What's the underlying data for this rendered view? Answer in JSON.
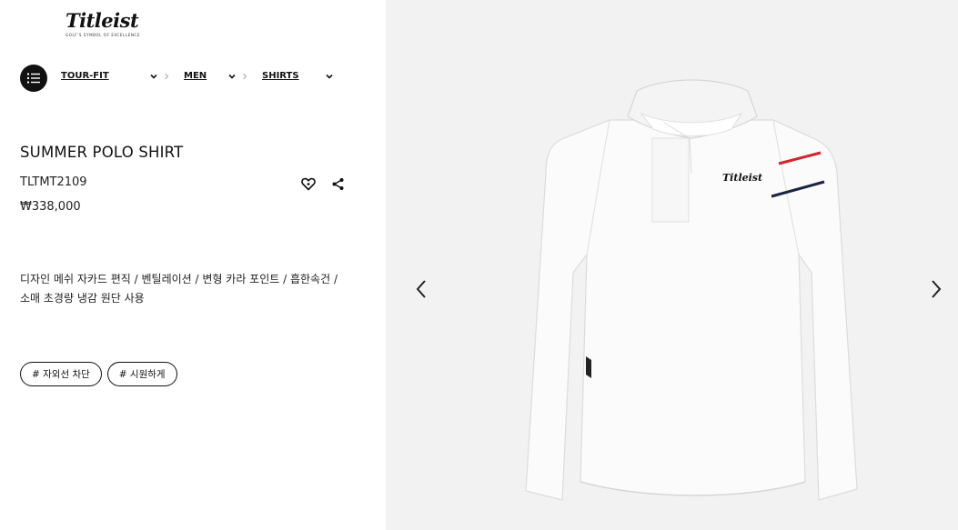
{
  "brand": {
    "name": "Titleist",
    "tagline": "GOLF'S SYMBOL OF EXCELLENCE"
  },
  "nav": {
    "menu_icon": "list-icon",
    "breadcrumbs": [
      {
        "label": "TOUR-FIT"
      },
      {
        "label": "MEN"
      },
      {
        "label": "SHIRTS"
      }
    ]
  },
  "product": {
    "name": "SUMMER POLO SHIRT",
    "code": "TLTMT2109",
    "price": "₩338,000",
    "description": "디자인 메쉬 자카드 편직 / 벤틸레이션 / 변형 카라 포인트 / 흡한속건 / 소매 초경량 냉감 원단 사용",
    "tags": [
      "# 자외선 차단",
      "# 시원하게"
    ],
    "image_logo_text": "Titleist",
    "actions": {
      "wishlist_icon": "heart-icon",
      "share_icon": "share-icon"
    }
  },
  "gallery": {
    "prev_icon": "chevron-left-icon",
    "next_icon": "chevron-right-icon"
  },
  "colors": {
    "accent_stripe_red": "#d2232a",
    "accent_stripe_navy": "#1a2440",
    "background_gallery": "#f2f2f2"
  }
}
